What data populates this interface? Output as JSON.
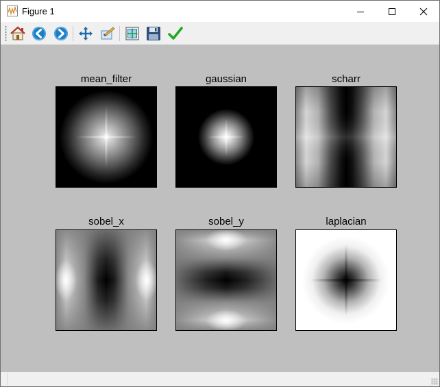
{
  "window": {
    "title": "Figure 1",
    "app_icon": "matplotlib-figure-icon",
    "controls": [
      "minimize-icon",
      "maximize-icon",
      "close-icon"
    ]
  },
  "toolbar": {
    "buttons": [
      {
        "name": "home",
        "icon": "home-icon"
      },
      {
        "name": "back",
        "icon": "back-arrow-icon"
      },
      {
        "name": "forward",
        "icon": "forward-arrow-icon"
      },
      {
        "name": "pan",
        "icon": "pan-move-icon"
      },
      {
        "name": "zoom",
        "icon": "zoom-rect-icon"
      },
      {
        "name": "subplots",
        "icon": "configure-subplots-icon"
      },
      {
        "name": "save",
        "icon": "floppy-save-icon"
      },
      {
        "name": "edit",
        "icon": "checkmark-edit-icon"
      }
    ]
  },
  "figure": {
    "background": "#bfbfbf",
    "panels": [
      {
        "title": "mean_filter"
      },
      {
        "title": "gaussian"
      },
      {
        "title": "scharr"
      },
      {
        "title": "sobel_x"
      },
      {
        "title": "sobel_y"
      },
      {
        "title": "laplacian"
      }
    ]
  }
}
